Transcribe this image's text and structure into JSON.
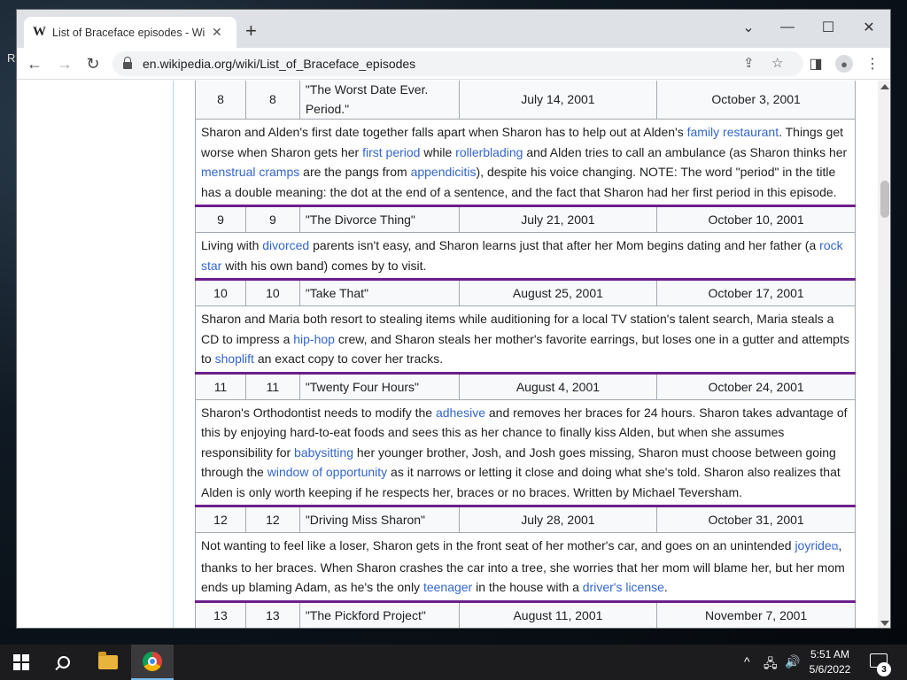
{
  "desktop": {
    "label": "R"
  },
  "browser": {
    "tab_title": "List of Braceface episodes - Wikipedia",
    "tab_favicon": "W",
    "url": "en.wikipedia.org/wiki/List_of_Braceface_episodes"
  },
  "episodes": [
    {
      "no_overall": "8",
      "no_season": "8",
      "title": "\"The Worst Date Ever. Period.\"",
      "original_air_date": "July 14, 2001",
      "us_air_date": "October 3, 2001",
      "desc_parts": [
        {
          "t": "Sharon and Alden's first date together falls apart when Sharon has to help out at Alden's "
        },
        {
          "t": "family restaurant",
          "link": true
        },
        {
          "t": ". Things get worse when Sharon gets her "
        },
        {
          "t": "first period",
          "link": true
        },
        {
          "t": " while "
        },
        {
          "t": "rollerblading",
          "link": true
        },
        {
          "t": " and Alden tries to call an ambulance (as Sharon thinks her "
        },
        {
          "t": "menstrual cramps",
          "link": true
        },
        {
          "t": " are the pangs from "
        },
        {
          "t": "appendicitis",
          "link": true
        },
        {
          "t": "), despite his voice changing. NOTE: The word \"period\" in the title has a double meaning: the dot at the end of a sentence, and the fact that Sharon had her first period in this episode."
        }
      ]
    },
    {
      "no_overall": "9",
      "no_season": "9",
      "title": "\"The Divorce Thing\"",
      "original_air_date": "July 21, 2001",
      "us_air_date": "October 10, 2001",
      "desc_parts": [
        {
          "t": "Living with "
        },
        {
          "t": "divorced",
          "link": true
        },
        {
          "t": " parents isn't easy, and Sharon learns just that after her Mom begins dating and her father (a "
        },
        {
          "t": "rock star",
          "link": true
        },
        {
          "t": " with his own band) comes by to visit."
        }
      ]
    },
    {
      "no_overall": "10",
      "no_season": "10",
      "title": "\"Take That\"",
      "original_air_date": "August 25, 2001",
      "us_air_date": "October 17, 2001",
      "desc_parts": [
        {
          "t": "Sharon and Maria both resort to stealing items while auditioning for a local TV station's talent search, Maria steals a CD to impress a "
        },
        {
          "t": "hip-hop",
          "link": true
        },
        {
          "t": " crew, and Sharon steals her mother's favorite earrings, but loses one in a gutter and attempts to "
        },
        {
          "t": "shoplift",
          "link": true
        },
        {
          "t": " an exact copy to cover her tracks."
        }
      ]
    },
    {
      "no_overall": "11",
      "no_season": "11",
      "title": "\"Twenty Four Hours\"",
      "original_air_date": "August 4, 2001",
      "us_air_date": "October 24, 2001",
      "desc_parts": [
        {
          "t": "Sharon's Orthodontist needs to modify the "
        },
        {
          "t": "adhesive",
          "link": true
        },
        {
          "t": " and removes her braces for 24 hours. Sharon takes advantage of this by enjoying hard-to-eat foods and sees this as her chance to finally kiss Alden, but when she assumes responsibility for "
        },
        {
          "t": "babysitting",
          "link": true
        },
        {
          "t": " her younger brother, Josh, and Josh goes missing, Sharon must choose between going through the "
        },
        {
          "t": "window of opportunity",
          "link": true
        },
        {
          "t": " as it narrows or letting it close and doing what she's told. Sharon also realizes that Alden is only worth keeping if he respects her, braces or no braces. Written by Michael Teversham."
        }
      ]
    },
    {
      "no_overall": "12",
      "no_season": "12",
      "title": "\"Driving Miss Sharon\"",
      "original_air_date": "July 28, 2001",
      "us_air_date": "October 31, 2001",
      "desc_parts": [
        {
          "t": "Not wanting to feel like a loser, Sharon gets in the front seat of her mother's car, and goes on an unintended "
        },
        {
          "t": "joyride",
          "link": true,
          "ext": true
        },
        {
          "t": ", thanks to her braces. When Sharon crashes the car into a tree, she worries that her mom will blame her, but her mom ends up blaming Adam, as he's the only "
        },
        {
          "t": "teenager",
          "link": true
        },
        {
          "t": " in the house with a "
        },
        {
          "t": "driver's license",
          "link": true
        },
        {
          "t": "."
        }
      ]
    },
    {
      "no_overall": "13",
      "no_season": "13",
      "title": "\"The Pickford Project\"",
      "original_air_date": "August 11, 2001",
      "us_air_date": "November 7, 2001",
      "desc_parts": []
    }
  ],
  "taskbar": {
    "time": "5:51 AM",
    "date": "5/6/2022",
    "notifications": "3"
  }
}
